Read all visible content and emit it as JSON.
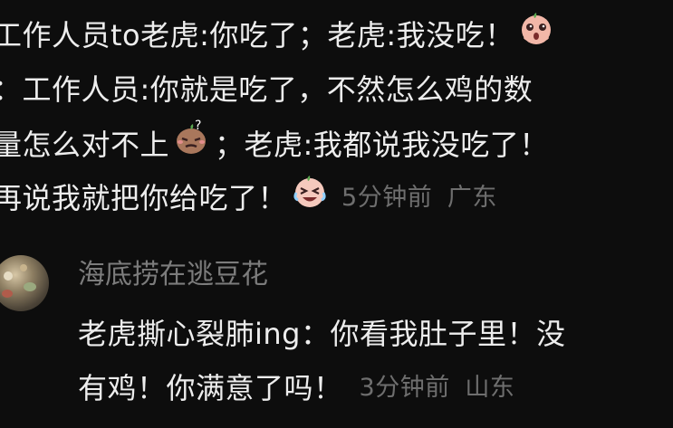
{
  "comment": {
    "line1": "工作人员to老虎:你吃了；老虎:我没吃！",
    "line2": "：工作人员:你就是吃了，不然怎么鸡的数",
    "line3_a": "量怎么对不上",
    "line3_b": "；老虎:我都说我没吃了！",
    "line4": "再说我就把你给吃了！",
    "time": "5分钟前",
    "location": "广东",
    "emoji1": "shocked-face-emoji",
    "emoji2": "sweating-confused-emoji",
    "emoji3": "crying-laughing-emoji"
  },
  "reply": {
    "username": "海底捞在逃豆花",
    "line1": "老虎撕心裂肺ing：你看我肚子里！没",
    "line2": "有鸡！你满意了吗！",
    "time": "3分钟前",
    "location": "山东"
  },
  "colors": {
    "background": "#0d0d0d",
    "text": "#ededed",
    "meta": "#6e6e6e",
    "username": "#7c7c7c"
  }
}
